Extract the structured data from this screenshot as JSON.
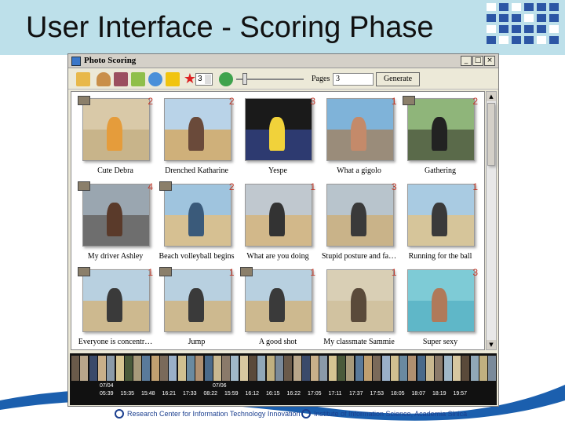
{
  "slide": {
    "title": "User Interface - Scoring Phase",
    "footer_left": "Research Center for Information Technology Innovation",
    "footer_right": "Institute of Information Science, Academia Sinica"
  },
  "app": {
    "window_title": "Photo Scoring",
    "win_minimize": "_",
    "win_maximize": "□",
    "win_close": "×",
    "toolbar": {
      "dropdown_value": "3",
      "pages_label": "Pages",
      "pages_value": "3",
      "generate_label": "Generate",
      "icons": [
        "folder-open-icon",
        "person-icon",
        "group-icon",
        "folder-icon",
        "refresh-icon",
        "lightning-icon",
        "star-icon",
        "green-arrow-icon"
      ]
    },
    "photos": [
      {
        "caption": "Cute Debra",
        "score": "2",
        "flag": true
      },
      {
        "caption": "Drenched Katharine",
        "score": "2",
        "flag": false
      },
      {
        "caption": "Yespe",
        "score": "3",
        "flag": false
      },
      {
        "caption": "What a gigolo",
        "score": "1",
        "flag": false
      },
      {
        "caption": "Gathering",
        "score": "2",
        "flag": true
      },
      {
        "caption": "My driver Ashley",
        "score": "4",
        "flag": true
      },
      {
        "caption": "Beach volleyball begins",
        "score": "2",
        "flag": true
      },
      {
        "caption": "What are you doing",
        "score": "1",
        "flag": false
      },
      {
        "caption": "Stupid posture and fa…",
        "score": "3",
        "flag": false
      },
      {
        "caption": "Running for the ball",
        "score": "1",
        "flag": false
      },
      {
        "caption": "Everyone is concentr…",
        "score": "1",
        "flag": true
      },
      {
        "caption": "Jump",
        "score": "1",
        "flag": true
      },
      {
        "caption": "A good shot",
        "score": "1",
        "flag": true
      },
      {
        "caption": "My classmate Sammie",
        "score": "1",
        "flag": false
      },
      {
        "caption": "Super sexy",
        "score": "3",
        "flag": false
      }
    ],
    "filmstrip": {
      "date1": "07/04",
      "date2": "07/06",
      "times": [
        "05:39",
        "15:35",
        "15:48",
        "16:21",
        "17:33",
        "08:22",
        "15:59",
        "16:12",
        "16:15",
        "16:22",
        "17:05",
        "17:11",
        "17:37",
        "17:53",
        "18:05",
        "18:07",
        "18:19",
        "19:57"
      ]
    }
  },
  "colors": {
    "score": "#c0392b",
    "slide_band": "#bde0ea",
    "footer_blue": "#1b3f8f"
  }
}
